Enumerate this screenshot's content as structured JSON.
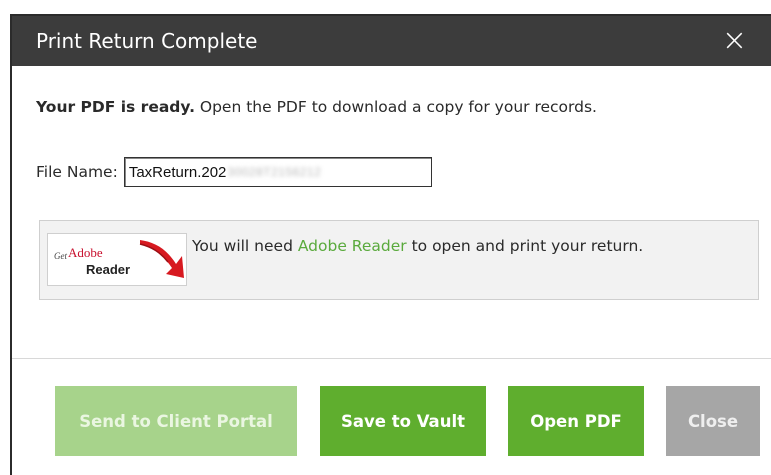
{
  "dialog": {
    "title": "Print Return Complete",
    "close_glyph": "×",
    "message_bold": "Your PDF is ready.",
    "message_rest": " Open the PDF to download a copy for your records.",
    "file_label": "File Name:",
    "file_value_visible": "TaxReturn.202",
    "file_value_blurred": "30028T2156212"
  },
  "adobe": {
    "badge_get": "Get",
    "badge_adobe": "Adobe",
    "badge_reader": "Reader",
    "text_before": "You will need ",
    "link": "Adobe Reader",
    "text_after": " to open and print your return."
  },
  "buttons": {
    "portal": "Send to Client Portal",
    "vault": "Save to Vault",
    "open": "Open PDF",
    "close": "Close"
  },
  "colors": {
    "titlebar": "#3c3c3c",
    "primary_green": "#5fae2e",
    "disabled_green": "#a7d38b",
    "close_gray": "#a6a6a6",
    "link_green": "#5aaa3d"
  }
}
